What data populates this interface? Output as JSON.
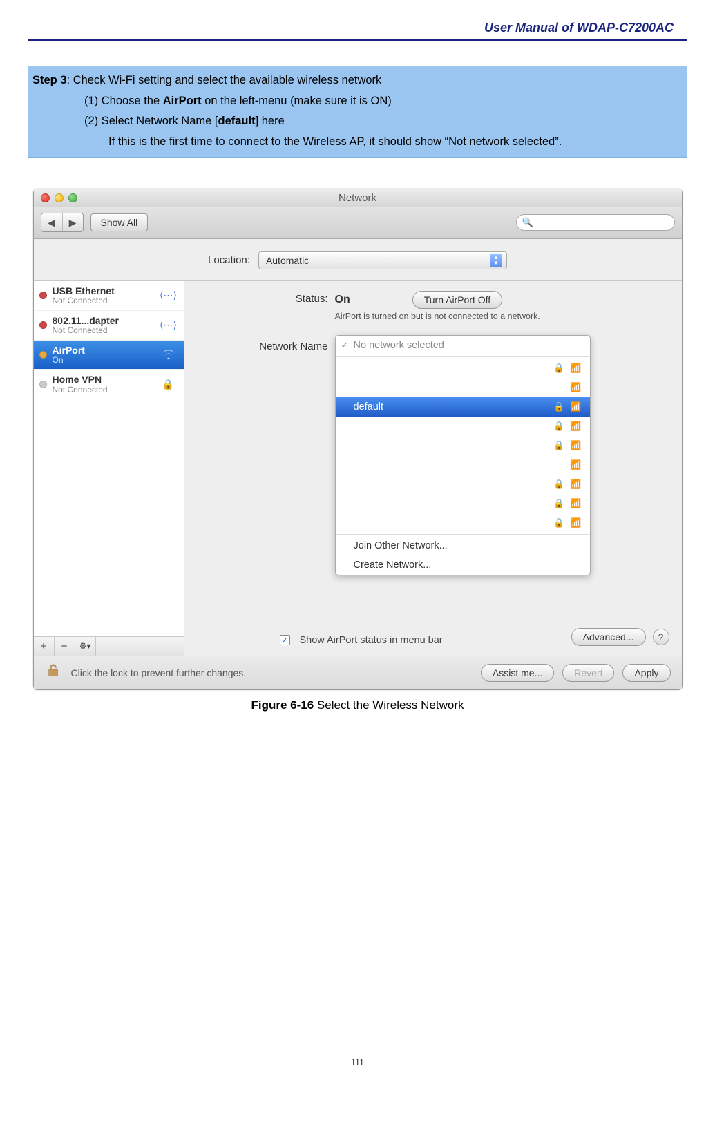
{
  "doc": {
    "header": "User  Manual  of  WDAP-C7200AC",
    "page_number": "111"
  },
  "step": {
    "title_prefix": "Step 3",
    "title_rest": ": Check Wi-Fi setting and select the available wireless network",
    "item1_pre": "(1)  Choose the ",
    "item1_bold": "AirPort",
    "item1_post": " on the left-menu (make sure it is ON)",
    "item2_pre": "(2)  Select Network Name [",
    "item2_bold": "default",
    "item2_post": "] here",
    "note": "If this is the first time to connect to the Wireless AP, it should show “Not network selected”."
  },
  "figure": {
    "num": "Figure 6-16",
    "caption": " Select the Wireless Network"
  },
  "win": {
    "title": "Network",
    "show_all": "Show All",
    "search_placeholder": "",
    "location_label": "Location:",
    "location_value": "Automatic",
    "services": [
      {
        "name": "USB Ethernet",
        "status": "Not Connected",
        "dot": "red",
        "icon": "arrows"
      },
      {
        "name": "802.11...dapter",
        "status": "Not Connected",
        "dot": "red",
        "icon": "arrows"
      },
      {
        "name": "AirPort",
        "status": "On",
        "dot": "amber",
        "icon": "wifi",
        "active": true
      },
      {
        "name": "Home VPN",
        "status": "Not Connected",
        "dot": "",
        "icon": "lock"
      }
    ],
    "footer_add": "+",
    "footer_remove": "−",
    "footer_gear": "⚙▾",
    "status_label": "Status:",
    "status_value": "On",
    "turn_off": "Turn AirPort Off",
    "status_sub": "AirPort is turned on but is not connected to a network.",
    "network_name_label": "Network Name",
    "dd_no_network": "No network selected",
    "dd_selected": "default",
    "dd_join": "Join Other Network...",
    "dd_create": "Create Network...",
    "show_menubar": "Show AirPort status in menu bar",
    "advanced": "Advanced...",
    "help": "?",
    "lock_text": "Click the lock to prevent further changes.",
    "assist": "Assist me...",
    "revert": "Revert",
    "apply": "Apply"
  }
}
